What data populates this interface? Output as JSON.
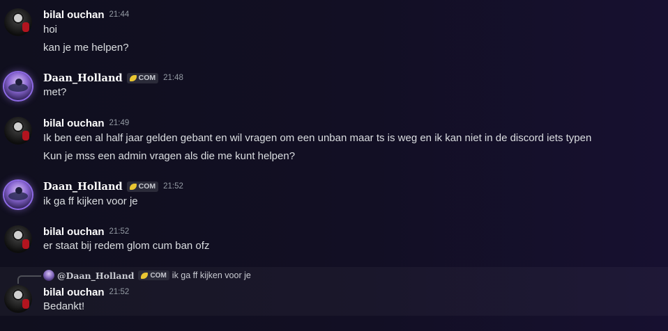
{
  "messages": [
    {
      "author": "bilal ouchan",
      "time": "21:44",
      "lines": [
        "hoi",
        "kan je me helpen?"
      ]
    },
    {
      "author": "Daan_Holland",
      "tag": "COM",
      "time": "21:48",
      "lines": [
        "met?"
      ]
    },
    {
      "author": "bilal ouchan",
      "time": "21:49",
      "lines": [
        "Ik ben een al half jaar gelden gebant en wil vragen om een unban maar ts is weg en ik kan niet in de discord iets typen",
        "Kun je mss een admin vragen als die me kunt helpen?"
      ]
    },
    {
      "author": "Daan_Holland",
      "tag": "COM",
      "time": "21:52",
      "lines": [
        "ik ga ff kijken voor je"
      ]
    },
    {
      "author": "bilal ouchan",
      "time": "21:52",
      "lines": [
        "er staat bij redem glom cum ban ofz"
      ]
    },
    {
      "reply": {
        "author": "@Daan_Holland",
        "tag": "COM",
        "text": "ik ga ff kijken voor je"
      },
      "author": "bilal ouchan",
      "time": "21:52",
      "lines": [
        "Bedankt!"
      ]
    }
  ],
  "icons": {
    "tag_icon": "leaf-icon",
    "tag_icon_color": "#e9c632"
  },
  "colors": {
    "background": "#100f1e",
    "username": "#ffffff",
    "text": "#dbdee1",
    "timestamp": "#949ba4"
  }
}
